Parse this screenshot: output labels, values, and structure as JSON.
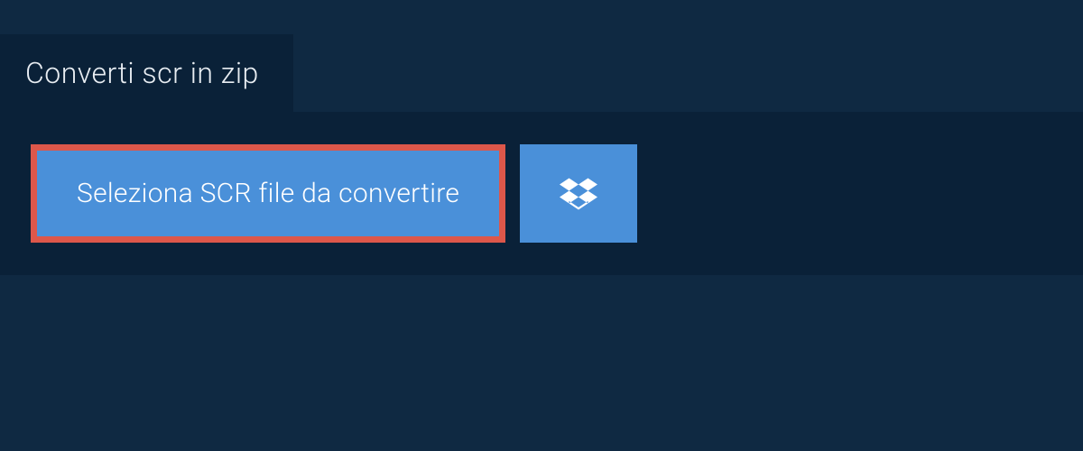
{
  "tab": {
    "label": "Converti scr in zip"
  },
  "actions": {
    "select_file_label": "Seleziona SCR file da convertire"
  }
}
